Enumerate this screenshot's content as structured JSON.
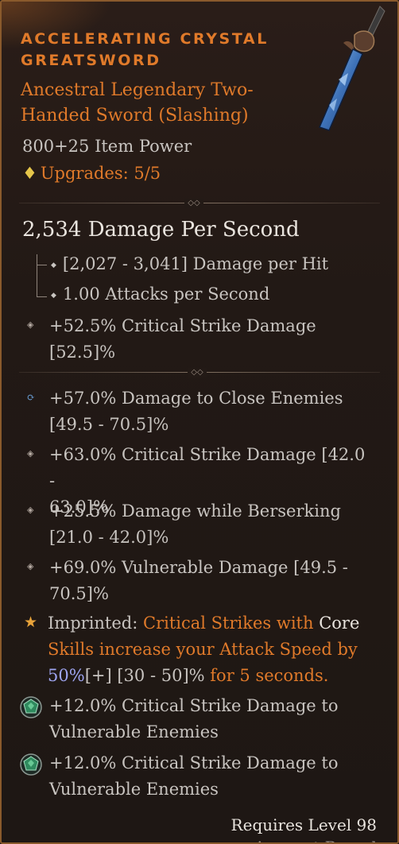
{
  "item": {
    "name": "ACCELERATING CRYSTAL GREATSWORD",
    "type": "Ancestral Legendary Two-Handed Sword (Slashing)",
    "item_power": "800+25 Item Power",
    "upgrades": "Upgrades: 5/5"
  },
  "stats": {
    "dps": "2,534 Damage Per Second",
    "damage_per_hit": "[2,027 - 3,041] Damage per Hit",
    "attacks_per_second": "1.00 Attacks per Second",
    "implicit": {
      "value": "+52.5% Critical Strike Damage",
      "range": "[52.5]%"
    }
  },
  "affixes": [
    {
      "line1": "+57.0% Damage to Close Enemies",
      "line2": "[49.5 - 70.5]%",
      "bullet": "greater-affix"
    },
    {
      "line1": "+63.0% Critical Strike Damage [42.0 -",
      "line2": "63.0]%",
      "bullet": "diamond"
    },
    {
      "line1": "+25.5% Damage while Berserking",
      "line2": "[21.0 - 42.0]%",
      "bullet": "diamond"
    },
    {
      "line1": "+69.0% Vulnerable Damage [49.5 -",
      "line2": "70.5]%",
      "bullet": "diamond"
    }
  ],
  "imprint": {
    "label": "Imprinted:",
    "text_a": "Critical Strikes with",
    "core": "Core",
    "text_b": "Skills increase your Attack Speed by",
    "value": "50%",
    "plus": "[+]",
    "range": "[30 - 50]%",
    "tail": "for 5 seconds."
  },
  "gems": [
    {
      "line1": "+12.0% Critical Strike Damage to",
      "line2": "Vulnerable Enemies"
    },
    {
      "line1": "+12.0% Critical Strike Damage to",
      "line2": "Vulnerable Enemies"
    }
  ],
  "footer": {
    "requires": "Requires Level 98",
    "cut_off": "Account Bound"
  },
  "icons": [
    "sword-icon",
    "diamond-icon",
    "star-icon",
    "emerald-gem-icon"
  ],
  "colors": {
    "legendary": "#e07a2a",
    "text": "#c8c4c0",
    "value_blue": "#9ea5f0"
  }
}
